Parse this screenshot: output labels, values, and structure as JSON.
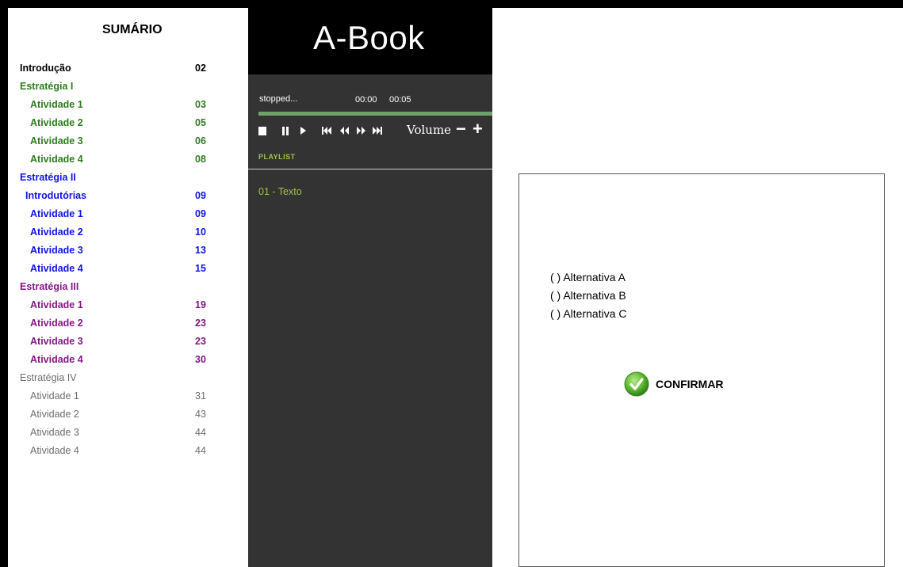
{
  "toc": {
    "title": "SUMÁRIO",
    "rows": [
      {
        "label": "Introdução",
        "page": "02"
      },
      {
        "label": "Estratégia I",
        "page": ""
      },
      {
        "label": "Atividade 1",
        "page": "03"
      },
      {
        "label": "Atividade 2",
        "page": "05"
      },
      {
        "label": "Atividade 3",
        "page": "06"
      },
      {
        "label": "Atividade 4",
        "page": "08"
      },
      {
        "label": "Estratégia II",
        "page": ""
      },
      {
        "label": "Introdutórias",
        "page": "09"
      },
      {
        "label": "Atividade 1",
        "page": "09"
      },
      {
        "label": "Atividade 2",
        "page": "10"
      },
      {
        "label": "Atividade 3",
        "page": "13"
      },
      {
        "label": "Atividade 4",
        "page": "15"
      },
      {
        "label": "Estratégia III",
        "page": ""
      },
      {
        "label": "Atividade 1",
        "page": "19"
      },
      {
        "label": "Atividade 2",
        "page": "23"
      },
      {
        "label": "Atividade 3",
        "page": "23"
      },
      {
        "label": "Atividade 4",
        "page": "30"
      },
      {
        "label": "Estratégia IV",
        "page": ""
      },
      {
        "label": "Atividade 1",
        "page": "31"
      },
      {
        "label": "Atividade 2",
        "page": "43"
      },
      {
        "label": "Atividade 3",
        "page": "44"
      },
      {
        "label": "Atividade 4",
        "page": "44"
      }
    ]
  },
  "player": {
    "app_title": "A-Book",
    "status": "stopped...",
    "time_current": "00:00",
    "time_total": "00:05",
    "volume_label": "Volume",
    "volume_minus": "−",
    "volume_plus": "+",
    "playlist_label": "PLAYLIST",
    "tracks": [
      "01 - Texto"
    ]
  },
  "question": {
    "options": [
      "( ) Alternativa A",
      "( ) Alternativa B",
      "( ) Alternativa C"
    ],
    "confirm_label": "CONFIRMAR"
  },
  "colors": {
    "section_green": "#2f7d1e",
    "section_blue": "#1014e6",
    "section_purple": "#861886",
    "section_gray": "#6e6e6e",
    "player_bg": "#333333",
    "progress": "#6da36a",
    "playlist_text": "#9fc24a",
    "confirm_icon": "#5cb82e"
  }
}
